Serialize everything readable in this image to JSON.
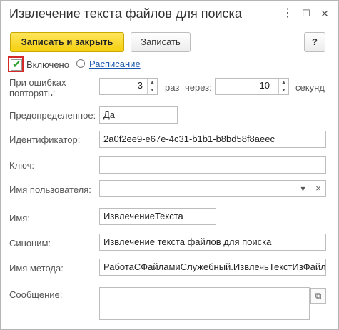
{
  "window": {
    "title": "Извлечение текста файлов для поиска",
    "more_icon": "⋮",
    "maximize_icon": "☐",
    "close_icon": "✕"
  },
  "toolbar": {
    "save_close_label": "Записать и закрыть",
    "save_label": "Записать",
    "help_label": "?"
  },
  "enabled": {
    "label": "Включено",
    "checked": true,
    "check_glyph": "✔"
  },
  "schedule": {
    "link": "Расписание"
  },
  "retry": {
    "label_line1": "При ошибках",
    "label_line2": "повторять:",
    "count": "3",
    "times_label": "раз",
    "through_label": "через:",
    "seconds_value": "10",
    "seconds_label": "секунд"
  },
  "fields": {
    "predefined": {
      "label": "Предопределенное:",
      "value": "Да"
    },
    "identifier": {
      "label": "Идентификатор:",
      "value": "2a0f2ee9-e67e-4c31-b1b1-b8bd58f8aeec"
    },
    "key": {
      "label": "Ключ:",
      "value": ""
    },
    "user_name": {
      "label": "Имя пользователя:",
      "value": "",
      "dropdown_icon": "▾",
      "clear_icon": "×"
    },
    "name": {
      "label": "Имя:",
      "value": "ИзвлечениеТекста"
    },
    "synonym": {
      "label": "Синоним:",
      "value": "Извлечение текста файлов для поиска"
    },
    "method_name": {
      "label": "Имя метода:",
      "value": "РаботаСФайламиСлужебный.ИзвлечьТекстИзФайлов"
    },
    "message": {
      "label": "Сообщение:",
      "value": "",
      "open_icon": "⧉"
    }
  },
  "spin": {
    "up": "▲",
    "down": "▼"
  }
}
